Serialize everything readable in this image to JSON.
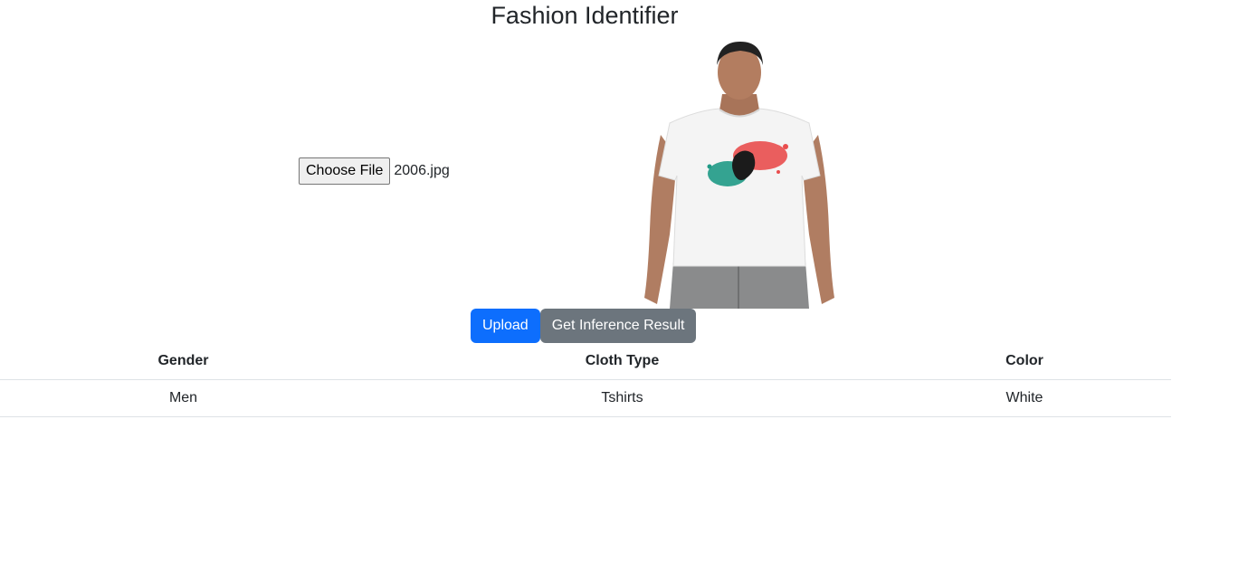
{
  "page": {
    "title": "Fashion Identifier"
  },
  "upload_form": {
    "choose_file_label": "Choose File",
    "selected_file": "2006.jpg",
    "upload_label": "Upload",
    "inference_label": "Get Inference Result"
  },
  "preview": {
    "alt": "uploaded image preview",
    "subject": "man wearing white t-shirt with red, green and black paint-splash graphic and grey shorts"
  },
  "results": {
    "headers": [
      "Gender",
      "Cloth Type",
      "Color"
    ],
    "rows": [
      [
        "Men",
        "Tshirts",
        "White"
      ]
    ]
  },
  "colors": {
    "primary": "#0d6efd",
    "secondary": "#6c757d",
    "border": "#dee2e6"
  }
}
